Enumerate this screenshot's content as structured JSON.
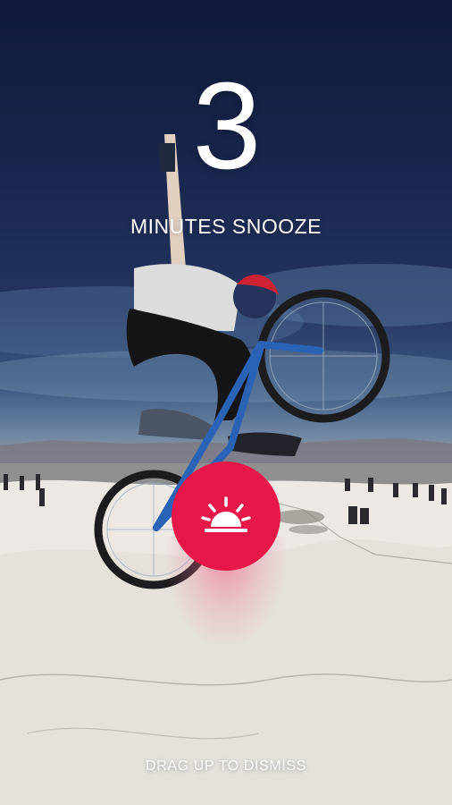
{
  "snooze": {
    "minutes": "3",
    "label": "MINUTES SNOOZE"
  },
  "alarm_button": {
    "icon": "sunrise-icon",
    "color": "#e8174a"
  },
  "hint": {
    "text": "DRAG UP TO DISMISS"
  }
}
